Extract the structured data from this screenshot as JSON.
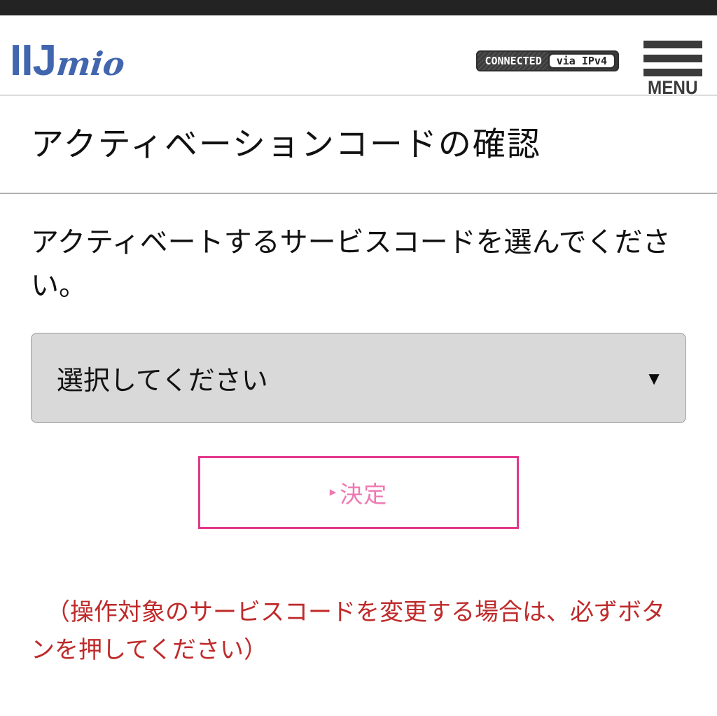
{
  "status_bar": {
    "visible": true
  },
  "header": {
    "logo": {
      "primary": "IIJ",
      "secondary": "mio"
    },
    "connection_badge": {
      "state_label": "CONNECTED",
      "protocol_label": "via IPv4"
    },
    "menu": {
      "label": "MENU"
    }
  },
  "page": {
    "title": "アクティベーションコードの確認"
  },
  "main": {
    "instruction": "アクティベートするサービスコードを選んでください。",
    "service_select": {
      "selected_label": "選択してください",
      "caret": "▼",
      "options": [
        "選択してください"
      ]
    },
    "submit_button": {
      "caret": "▸",
      "label": "決定"
    },
    "note": "（操作対象のサービスコードを変更する場合は、必ずボタンを押してください）"
  },
  "colors": {
    "brand_blue": "#4166ae",
    "accent_pink_border": "#e2378c",
    "accent_pink_text": "#ee7ab3",
    "note_red": "#bf2a2a",
    "select_gray": "#d9d9d9",
    "status_bar_dark": "#232323"
  }
}
